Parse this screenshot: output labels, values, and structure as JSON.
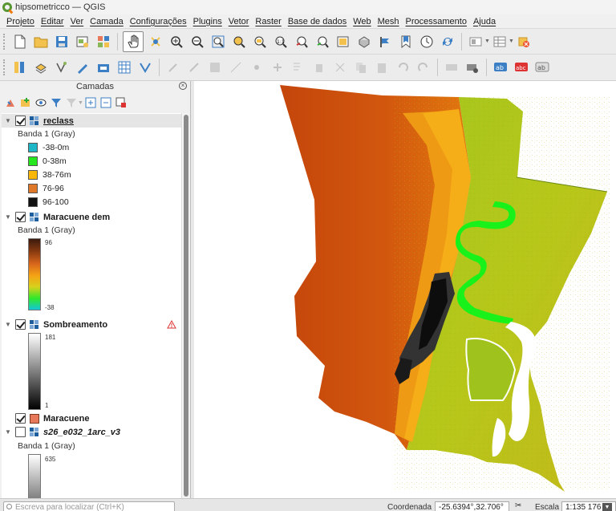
{
  "window": {
    "title": "hipsometricco — QGIS"
  },
  "menu": [
    "Projeto",
    "Editar",
    "Ver",
    "Camada",
    "Configurações",
    "Plugins",
    "Vetor",
    "Raster",
    "Base de dados",
    "Web",
    "Mesh",
    "Processamento",
    "Ajuda"
  ],
  "panel": {
    "title": "Camadas"
  },
  "layers": {
    "reclass": {
      "name": "reclass",
      "band": "Banda 1 (Gray)",
      "classes": [
        {
          "label": "-38-0m",
          "color": "#1fb7c8"
        },
        {
          "label": "0-38m",
          "color": "#26e61e"
        },
        {
          "label": "38-76m",
          "color": "#fbb808"
        },
        {
          "label": "76-96",
          "color": "#e0782a"
        },
        {
          "label": "96-100",
          "color": "#111111"
        }
      ]
    },
    "dem": {
      "name": "Maracuene dem",
      "band": "Banda 1 (Gray)",
      "max": "96",
      "min": "-38"
    },
    "hillshade": {
      "name": "Sombreamento",
      "max": "181",
      "min": "1"
    },
    "vector": {
      "name": "Maracuene",
      "color": "#e8785a"
    },
    "srtm": {
      "name": "s26_e032_1arc_v3",
      "band": "Banda 1 (Gray)",
      "max": "635"
    }
  },
  "statusbar": {
    "search_placeholder": "Escreva para localizar (Ctrl+K)",
    "coord_label": "Coordenada",
    "coord_value": "-25.6394°,32.706°",
    "scale_label": "Escala",
    "scale_value": "1:135 176"
  },
  "colors": {
    "accent": "#589632",
    "orange": "#ee7913",
    "map_bg": "#ffffff"
  }
}
